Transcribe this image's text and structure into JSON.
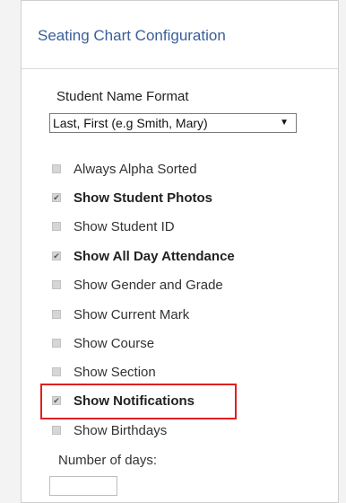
{
  "panel": {
    "title": "Seating Chart Configuration",
    "name_format": {
      "label": "Student Name Format",
      "selected": "Last, First (e.g Smith, Mary)",
      "caret": "▼"
    },
    "options": [
      {
        "label": "Always Alpha Sorted",
        "checked": false
      },
      {
        "label": "Show Student Photos",
        "checked": true
      },
      {
        "label": "Show Student ID",
        "checked": false
      },
      {
        "label": "Show All Day Attendance",
        "checked": true
      },
      {
        "label": "Show Gender and Grade",
        "checked": false
      },
      {
        "label": "Show Current Mark",
        "checked": false
      },
      {
        "label": "Show Course",
        "checked": false
      },
      {
        "label": "Show Section",
        "checked": false
      },
      {
        "label": "Show Notifications",
        "checked": true
      },
      {
        "label": "Show Birthdays",
        "checked": false
      }
    ],
    "days_label": "Number of days:",
    "days_value": ""
  },
  "colors": {
    "title": "#3a5f99",
    "highlight": "#e02020"
  }
}
